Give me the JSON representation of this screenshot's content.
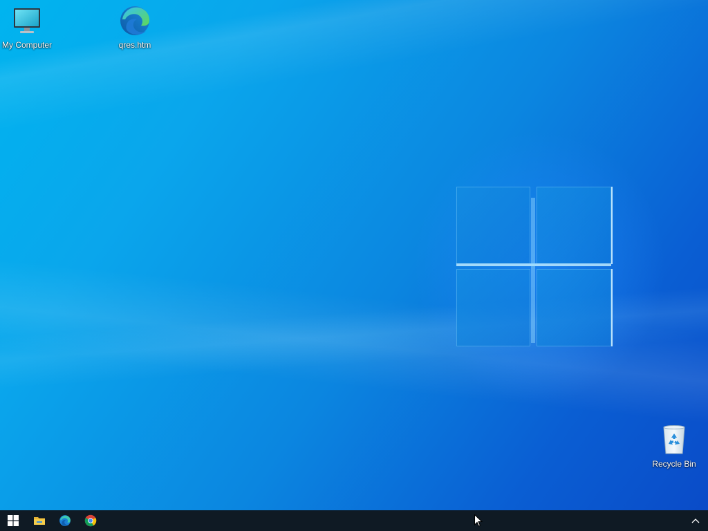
{
  "desktop": {
    "icons": [
      {
        "label": "My Computer",
        "icon": "monitor-icon"
      },
      {
        "label": "qres.htm",
        "icon": "edge-icon"
      },
      {
        "label": "Recycle Bin",
        "icon": "recycle-bin-icon"
      }
    ]
  },
  "taskbar": {
    "items": [
      {
        "icon": "windows-start-icon"
      },
      {
        "icon": "file-explorer-icon"
      },
      {
        "icon": "edge-icon"
      },
      {
        "icon": "chrome-icon"
      }
    ],
    "tray": {
      "icon": "chevron-up-icon"
    }
  },
  "colors": {
    "taskbar": "#0f1a24",
    "wallpaper_light": "#00b4ef",
    "wallpaper_dark": "#0a4ac7"
  }
}
